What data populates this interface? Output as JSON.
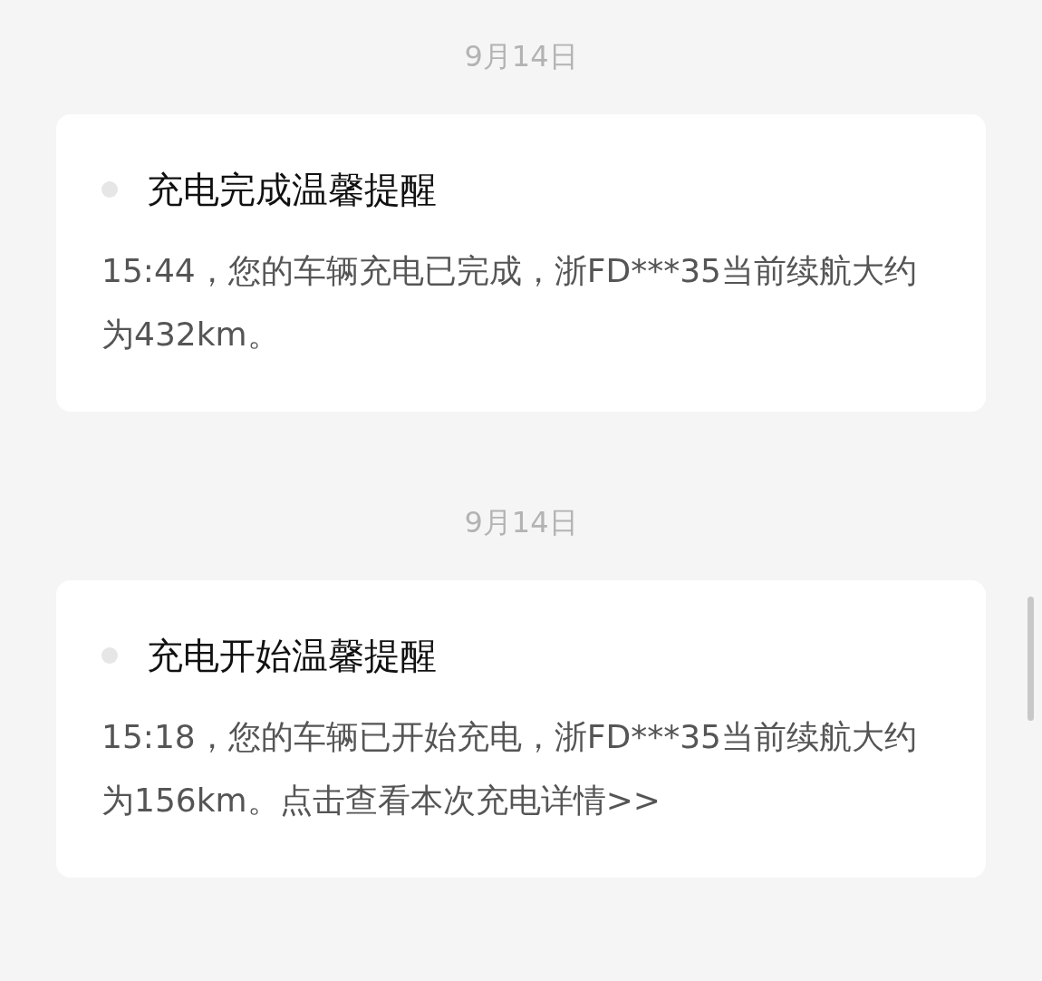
{
  "messages": [
    {
      "date": "9月14日",
      "title": "充电完成温馨提醒",
      "read": true,
      "body": "15:44，您的车辆充电已完成，浙FD***35当前续航大约为432km。"
    },
    {
      "date": "9月14日",
      "title": "充电开始温馨提醒",
      "read": true,
      "body": "15:18，您的车辆已开始充电，浙FD***35当前续航大约为156km。点击查看本次充电详情>>"
    }
  ]
}
